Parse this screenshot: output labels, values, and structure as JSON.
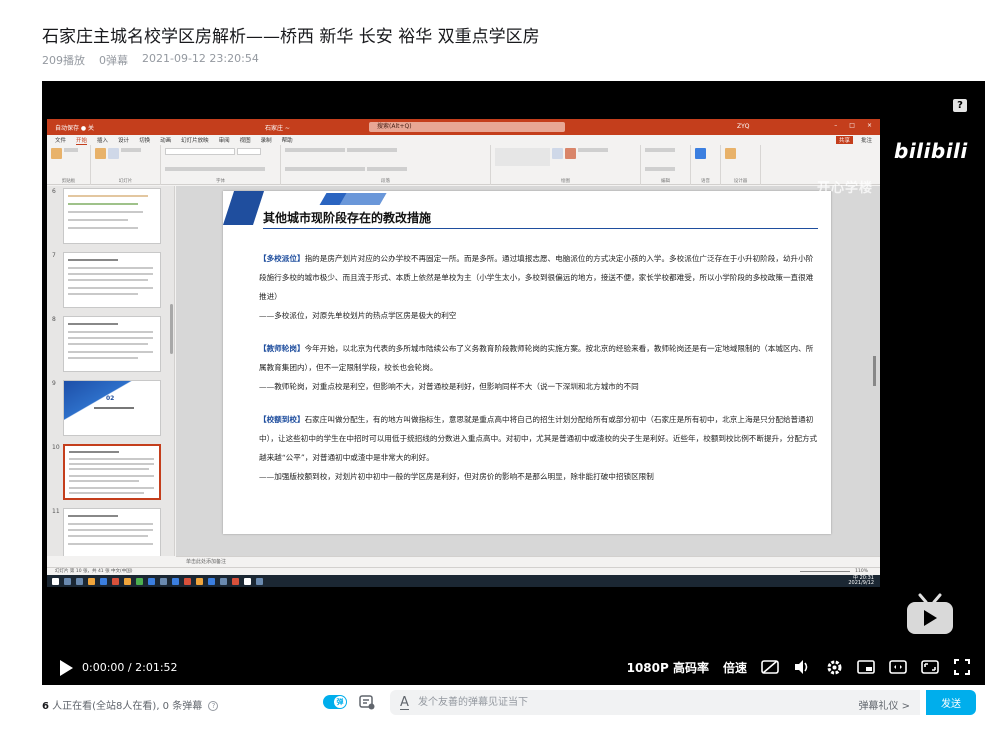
{
  "video": {
    "title": "石家庄主城名校学区房解析——桥西 新华 长安 裕华 双重点学区房",
    "plays": "209播放",
    "danmaku_count": "0弹幕",
    "date": "2021-09-12 23:20:54"
  },
  "ppt": {
    "autosave": "自动保存 ● 关",
    "docname": "石家庄 ~",
    "search": "搜索(Alt+Q)",
    "user": "ZYQ",
    "tabs": [
      "文件",
      "开始",
      "插入",
      "设计",
      "切换",
      "动画",
      "幻灯片放映",
      "审阅",
      "视图",
      "录制",
      "帮助"
    ],
    "share": "共享",
    "comment": "批注",
    "groups": [
      "剪贴板",
      "幻灯片",
      "字体",
      "段落",
      "绘图",
      "编辑",
      "语音",
      "设计器"
    ],
    "watermark": "开心学楼",
    "slide_numbers": [
      "6",
      "7",
      "8",
      "9",
      "10",
      "11"
    ],
    "thumb_9_text": "02",
    "slide": {
      "title": "其他城市现阶段存在的教改措施",
      "paragraphs": [
        {
          "keyword": "【多校派位】",
          "text": "指的是房产划片对应的公办学校不再固定一所。而是多所。通过填报志愿、电脑派位的方式决定小孩的入学。多校派位广泛存在于小升初阶段，幼升小阶段施行多校的城市极少、而且流于形式、本质上依然是单校为主（小学生太小，多校到很偏远的地方，接送不便，家长学校都难受，所以小学阶段的多校政策一直很难推进）",
          "note": "——多校派位，对原先单校划片的热点学区房是极大的利空"
        },
        {
          "keyword": "【教师轮岗】",
          "text": "今年开始，以北京为代表的多所城市陆续公布了义务教育阶段教师轮岗的实施方案。按北京的经验来看，教师轮岗还是有一定地域限制的（本城区内、所属教育集团内），但不一定限制学段，校长也会轮岗。",
          "note": "——教师轮岗，对重点校是利空，但影响不大，对普通校是利好，但影响同样不大（说一下深圳和北方城市的不同"
        },
        {
          "keyword": "【校额到校】",
          "text": "石家庄叫做分配生，有的地方叫做指标生，意思就是重点高中将自己的招生计划分配给所有或部分初中（石家庄是所有初中，北京上海是只分配给普通初中），让这些初中的学生在中招时可以用低于统招线的分数进入重点高中。对初中，尤其是普通初中或渣校的尖子生是利好。近些年，校额到校比例不断提升，分配方式越来越“公平”，对普通初中或渣中是非常大的利好。",
          "note": "——加强版校额到校，对划片初中初中一般的学区房是利好，但对房价的影响不是那么明显，除非能打破中招锁区限制"
        }
      ]
    },
    "notes_placeholder": "单击此处添加备注",
    "status": "幻灯片 第 10 张，共 41 张    中文(中国)",
    "zoom": "110%",
    "tray_time": "20:31",
    "tray_date": "2021/9/12",
    "tray_lang": "中"
  },
  "player": {
    "help": "?",
    "brand": "bilibili",
    "time_current": "0:00:00",
    "time_sep": "/",
    "time_total": "2:01:52",
    "quality": "1080P 高码率",
    "speed": "倍速"
  },
  "footer": {
    "watching_count": "6",
    "watching_text": "人正在看(全站8人在看), 0 条弹幕",
    "toggle_label": "弹",
    "input_placeholder": "发个友善的弹幕见证当下",
    "etiquette": "弹幕礼仪 >",
    "send": "发送"
  },
  "colors": {
    "ppt_red": "#c43e1c",
    "accent_blue": "#00aeec",
    "slide_blue": "#1f4e9e"
  }
}
